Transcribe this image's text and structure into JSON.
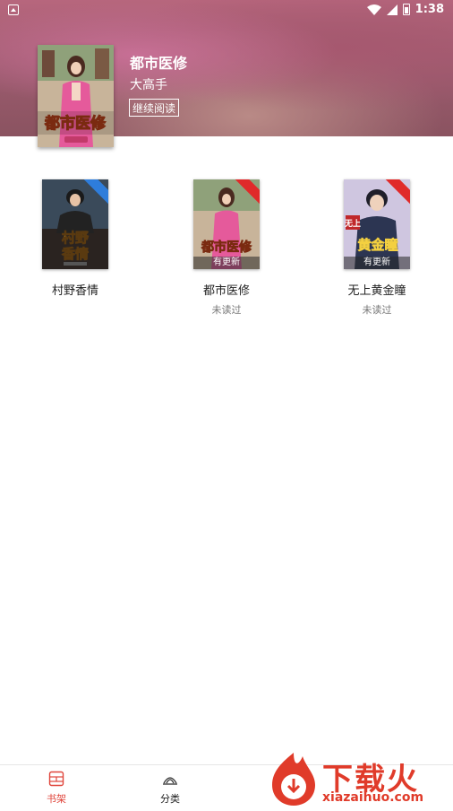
{
  "status_bar": {
    "time": "1:38"
  },
  "featured": {
    "title": "都市医修",
    "author": "大高手",
    "continue_label": "继续阅读",
    "cover_text": "都市医修"
  },
  "books": [
    {
      "name": "村野香情",
      "cover_text": "村野香情",
      "badge": "",
      "update": "",
      "status": ""
    },
    {
      "name": "都市医修",
      "cover_text": "都市医修",
      "badge": "",
      "update": "有更新",
      "status": "未读过"
    },
    {
      "name": "无上黄金瞳",
      "cover_text": "黄金瞳",
      "cover_text_small": "无上",
      "badge": "",
      "update": "有更新",
      "status": "未读过"
    }
  ],
  "nav": [
    {
      "label": "书架",
      "icon": "bookshelf-icon",
      "active": true
    },
    {
      "label": "分类",
      "icon": "category-icon",
      "active": false
    }
  ],
  "watermark": {
    "text": "下载火",
    "url": "xiazaihuo.com"
  },
  "colors": {
    "accent": "#e0453b",
    "hero": "#b7667d",
    "ribbon_blue": "#2e7ddb",
    "ribbon_red": "#e02a2a"
  }
}
